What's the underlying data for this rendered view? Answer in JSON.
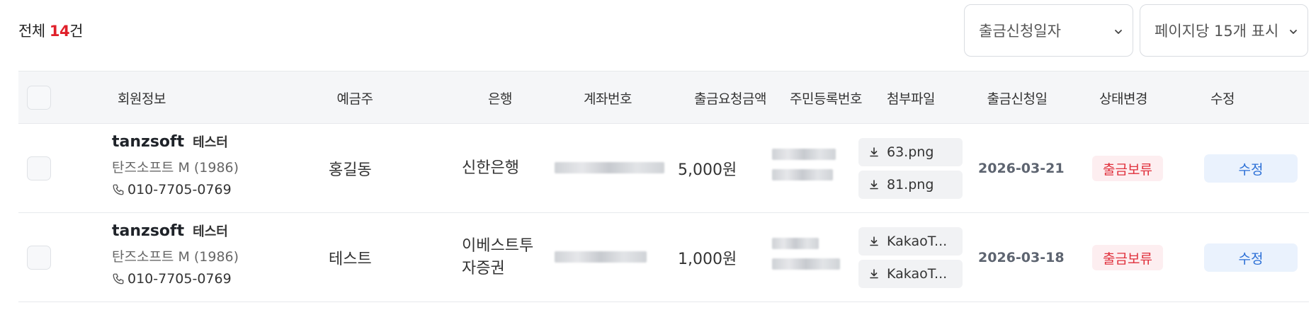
{
  "summary": {
    "prefix": "전체 ",
    "count": "14",
    "suffix": "건"
  },
  "controls": {
    "date_select": "출금신청일자",
    "page_size_select": "페이지당 15개 표시"
  },
  "columns": [
    "회원정보",
    "예금주",
    "은행",
    "계좌번호",
    "출금요청금액",
    "주민등록번호",
    "첨부파일",
    "출금신청일",
    "상태변경",
    "수정"
  ],
  "rows": [
    {
      "user_id": "tanzsoft",
      "user_tag": "테스터",
      "user_sub": "탄즈소프트 M (1986)",
      "phone": "010-7705-0769",
      "depositor": "홍길동",
      "bank_line1": "신한은행",
      "bank_line2": "",
      "amount": "5,000원",
      "files": [
        "63.png",
        "81.png"
      ],
      "date": "2026-03-21",
      "status": "출금보류",
      "edit": "수정"
    },
    {
      "user_id": "tanzsoft",
      "user_tag": "테스터",
      "user_sub": "탄즈소프트 M (1986)",
      "phone": "010-7705-0769",
      "depositor": "테스트",
      "bank_line1": "이베스트투",
      "bank_line2": "자증권",
      "amount": "1,000원",
      "files": [
        "KakaoT...",
        "KakaoT..."
      ],
      "date": "2026-03-18",
      "status": "출금보류",
      "edit": "수정"
    }
  ],
  "icons": {
    "chevron": "chevron-down-icon",
    "phone": "phone-icon",
    "download": "download-icon"
  },
  "colors": {
    "count_accent": "#e0202a",
    "status_text": "#e0303c",
    "status_bg": "#fdeef0",
    "edit_text": "#2b6fd6",
    "edit_bg": "#eaf2fd"
  }
}
